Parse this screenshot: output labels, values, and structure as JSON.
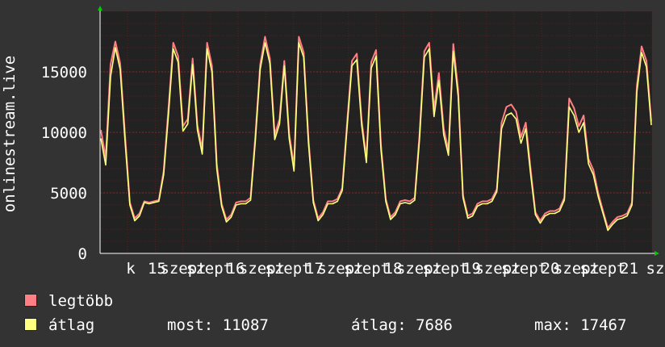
{
  "chart_data": {
    "type": "area",
    "ylabel": "onlinestream.live",
    "ylim": [
      0,
      20000
    ],
    "yticks": [
      0,
      5000,
      10000,
      15000
    ],
    "ytick_labels": [
      "0",
      "5000",
      "10000",
      "15000"
    ],
    "xtick_labels": [
      "k",
      "15",
      "szept",
      "szept",
      "16",
      "szept",
      "szept",
      "17",
      "szept",
      "szept",
      "18",
      "szept",
      "szept",
      "19",
      "szept",
      "szept",
      "20",
      "szept",
      "szept",
      "21",
      "sz"
    ],
    "grid": true,
    "colors": {
      "background": "#333333",
      "plot": "#222222",
      "grid": "#5a1f1f",
      "legtobb": "#ff7f85",
      "atlag": "#ffff80",
      "axis_arrow": "#00cc00"
    },
    "series": [
      {
        "name": "legtöbb",
        "values": [
          10200,
          7900,
          15600,
          17500,
          15700,
          9800,
          4200,
          2900,
          3300,
          4300,
          4200,
          4300,
          4400,
          6800,
          12000,
          17400,
          16300,
          10500,
          11100,
          16100,
          10600,
          8600,
          17400,
          15500,
          7400,
          4100,
          2800,
          3200,
          4200,
          4300,
          4300,
          4600,
          9700,
          15600,
          17900,
          16100,
          9800,
          11100,
          15900,
          9900,
          7200,
          17900,
          16600,
          9500,
          4400,
          2900,
          3400,
          4300,
          4300,
          4500,
          5400,
          10800,
          15900,
          16500,
          11000,
          7900,
          15800,
          16800,
          9000,
          4500,
          3000,
          3400,
          4300,
          4400,
          4300,
          4600,
          9800,
          16700,
          17400,
          11900,
          14900,
          10300,
          8500,
          17300,
          13500,
          4800,
          3100,
          3300,
          4100,
          4300,
          4300,
          4500,
          5300,
          10800,
          12100,
          12300,
          11700,
          9600,
          10800,
          7000,
          3400,
          2700,
          3300,
          3500,
          3500,
          3700,
          4600,
          12800,
          12000,
          10500,
          11400,
          7800,
          6900,
          5000,
          3500,
          2100,
          2600,
          3000,
          3100,
          3300,
          4200,
          13800,
          17100,
          15900,
          10900
        ]
      },
      {
        "name": "átlag",
        "values": [
          9500,
          7300,
          14600,
          17000,
          15200,
          9300,
          4000,
          2700,
          3100,
          4200,
          4100,
          4200,
          4300,
          6500,
          11500,
          16900,
          15800,
          10100,
          10700,
          15600,
          10200,
          8200,
          16900,
          15000,
          7000,
          3900,
          2600,
          3000,
          4000,
          4100,
          4100,
          4400,
          9300,
          15200,
          17400,
          15700,
          9400,
          10700,
          15500,
          9500,
          6800,
          17400,
          16200,
          9100,
          4200,
          2700,
          3200,
          4100,
          4100,
          4300,
          5200,
          10400,
          15500,
          16000,
          10600,
          7500,
          15300,
          16300,
          8600,
          4300,
          2800,
          3200,
          4100,
          4200,
          4100,
          4400,
          9400,
          16200,
          16900,
          11300,
          14300,
          9800,
          8100,
          16700,
          13000,
          4600,
          2900,
          3100,
          3900,
          4100,
          4100,
          4300,
          5100,
          10300,
          11400,
          11600,
          11100,
          9100,
          10300,
          6600,
          3200,
          2500,
          3100,
          3300,
          3300,
          3500,
          4400,
          12100,
          11400,
          10000,
          10800,
          7400,
          6500,
          4700,
          3300,
          1900,
          2400,
          2800,
          2900,
          3100,
          4000,
          13300,
          16600,
          15400,
          10600
        ]
      }
    ],
    "legend": "bottom-left",
    "stats": {
      "most_label": "most:",
      "most": "11087",
      "atlag_label": "átlag:",
      "atlag": "7686",
      "max_label": "max:",
      "max": "17467"
    }
  }
}
